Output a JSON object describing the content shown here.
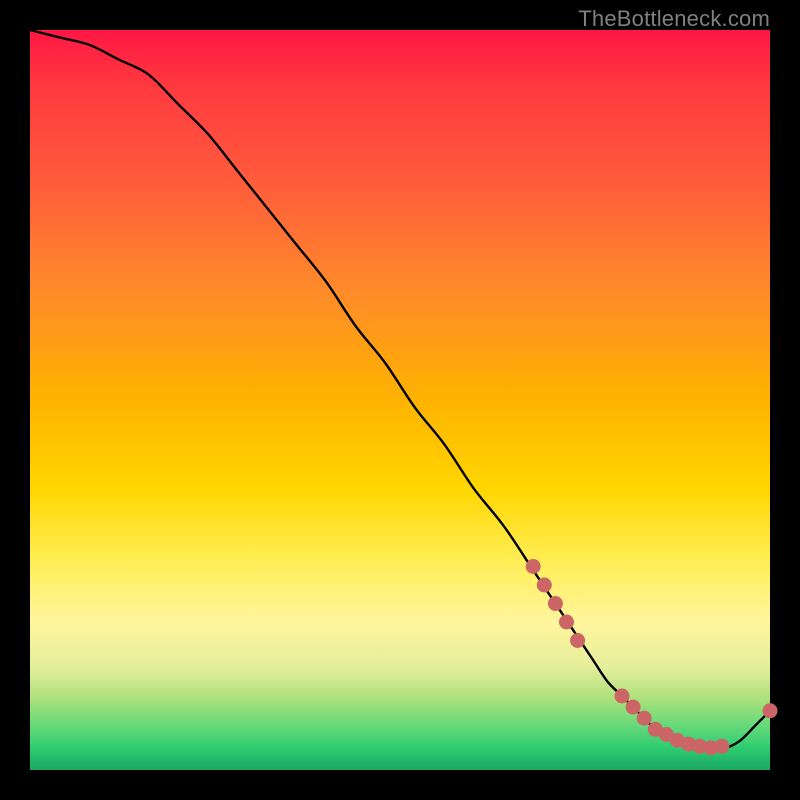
{
  "watermark": "TheBottleneck.com",
  "chart_data": {
    "type": "line",
    "title": "",
    "xlabel": "",
    "ylabel": "",
    "xlim": [
      0,
      100
    ],
    "ylim": [
      0,
      100
    ],
    "grid": false,
    "legend": false,
    "series": [
      {
        "name": "bottleneck-curve",
        "x": [
          0,
          4,
          8,
          12,
          16,
          20,
          24,
          28,
          32,
          36,
          40,
          44,
          48,
          52,
          56,
          60,
          64,
          68,
          70,
          72,
          74,
          76,
          78,
          80,
          82,
          84,
          86,
          88,
          90,
          92,
          94,
          96,
          98,
          100
        ],
        "y": [
          100,
          99,
          98,
          96,
          94,
          90,
          86,
          81,
          76,
          71,
          66,
          60,
          55,
          49,
          44,
          38,
          33,
          27,
          24,
          21,
          18,
          15,
          12,
          10,
          8,
          6,
          5,
          4,
          3,
          3,
          3,
          4,
          6,
          8
        ]
      }
    ],
    "markers": [
      {
        "name": "pt-a",
        "x": 68.0,
        "y": 27.5
      },
      {
        "name": "pt-b",
        "x": 69.5,
        "y": 25.0
      },
      {
        "name": "pt-c",
        "x": 71.0,
        "y": 22.5
      },
      {
        "name": "pt-d",
        "x": 72.5,
        "y": 20.0
      },
      {
        "name": "pt-e",
        "x": 74.0,
        "y": 17.5
      },
      {
        "name": "pt-f",
        "x": 80.0,
        "y": 10.0
      },
      {
        "name": "pt-g",
        "x": 81.5,
        "y": 8.5
      },
      {
        "name": "pt-h",
        "x": 83.0,
        "y": 7.0
      },
      {
        "name": "pt-i",
        "x": 84.5,
        "y": 5.5
      },
      {
        "name": "pt-j",
        "x": 86.0,
        "y": 4.8
      },
      {
        "name": "pt-k",
        "x": 87.5,
        "y": 4.0
      },
      {
        "name": "pt-l",
        "x": 89.0,
        "y": 3.5
      },
      {
        "name": "pt-m",
        "x": 90.5,
        "y": 3.2
      },
      {
        "name": "pt-n",
        "x": 92.0,
        "y": 3.0
      },
      {
        "name": "pt-o",
        "x": 93.5,
        "y": 3.2
      },
      {
        "name": "pt-p",
        "x": 100.0,
        "y": 8.0
      }
    ],
    "colors": {
      "curve": "#000000",
      "marker": "#cc6666"
    }
  }
}
